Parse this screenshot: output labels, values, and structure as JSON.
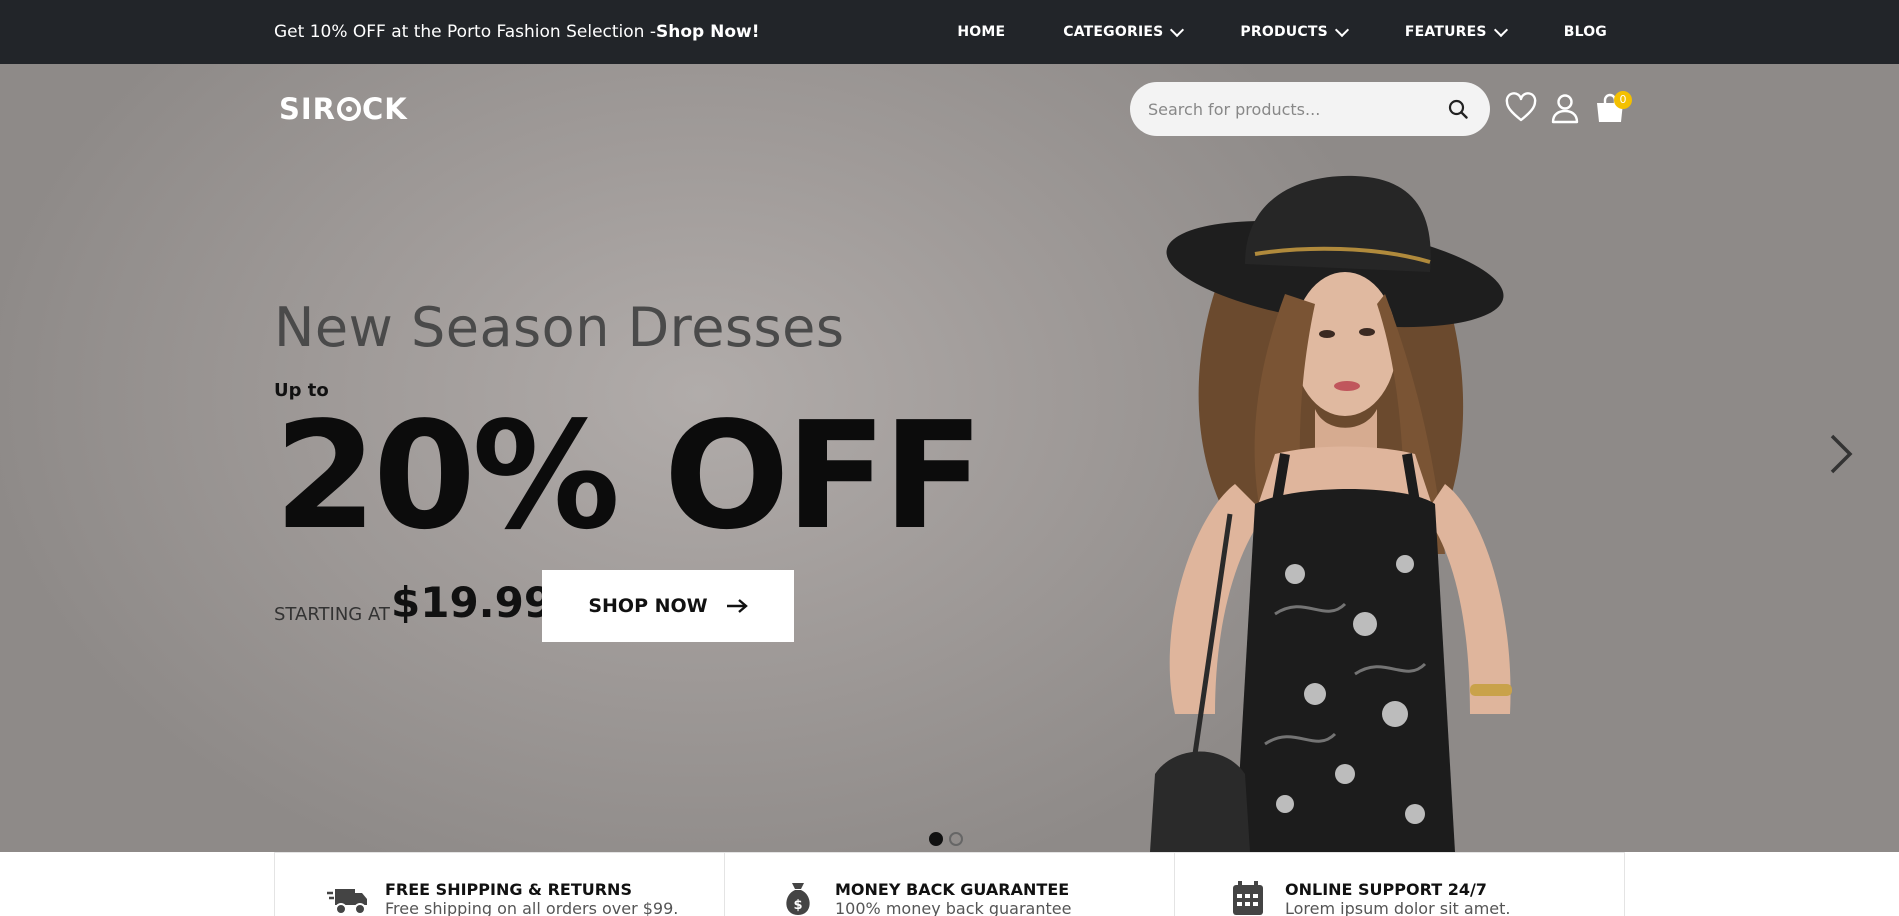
{
  "topbar": {
    "promo_text": "Get 10% OFF at the Porto Fashion Selection -",
    "promo_link": "Shop Now!",
    "nav": [
      {
        "label": "HOME",
        "dropdown": false
      },
      {
        "label": "CATEGORIES",
        "dropdown": true
      },
      {
        "label": "PRODUCTS",
        "dropdown": true
      },
      {
        "label": "FEATURES",
        "dropdown": true
      },
      {
        "label": "BLOG",
        "dropdown": false
      }
    ]
  },
  "header": {
    "logo_left": "SIR",
    "logo_right": "CK",
    "search_placeholder": "Search for products...",
    "cart_count": "0",
    "icons": [
      "search-icon",
      "heart-icon",
      "user-icon",
      "shopping-bag-icon"
    ]
  },
  "hero": {
    "headline": "New Season Dresses",
    "upto": "Up to",
    "discount": "20% OFF",
    "starting_at": "STARTING AT",
    "price": "$19.99",
    "button_label": "SHOP NOW",
    "active_slide": 1,
    "slide_count": 2
  },
  "features": [
    {
      "icon": "truck-icon",
      "title": "FREE SHIPPING & RETURNS",
      "desc": "Free shipping on all orders over $99."
    },
    {
      "icon": "money-bag-icon",
      "title": "MONEY BACK GUARANTEE",
      "desc": "100% money back guarantee"
    },
    {
      "icon": "calendar-icon",
      "title": "ONLINE SUPPORT 24/7",
      "desc": "Lorem ipsum dolor sit amet."
    }
  ],
  "colors": {
    "topbar_bg": "#222529",
    "hero_bg": "#a19c9a",
    "badge": "#f4c000"
  }
}
